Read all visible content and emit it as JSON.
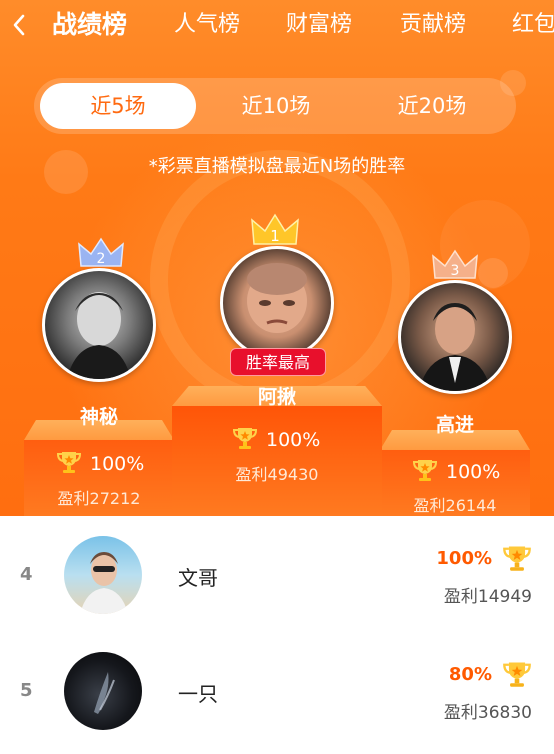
{
  "header": {
    "back_icon": "chevron-left-icon",
    "tabs": [
      {
        "label": "战绩榜",
        "active": true
      },
      {
        "label": "人气榜",
        "active": false
      },
      {
        "label": "财富榜",
        "active": false
      },
      {
        "label": "贡献榜",
        "active": false
      },
      {
        "label": "红包",
        "active": false
      }
    ]
  },
  "range_tabs": [
    {
      "label": "近5场",
      "active": true
    },
    {
      "label": "近10场",
      "active": false
    },
    {
      "label": "近20场",
      "active": false
    }
  ],
  "note": "*彩票直播模拟盘最近N场的胜率",
  "top3": [
    {
      "rank": "1",
      "name": "阿揪",
      "win_rate": "100%",
      "profit": "盈利49430",
      "badge": "胜率最高"
    },
    {
      "rank": "2",
      "name": "神秘",
      "win_rate": "100%",
      "profit": "盈利27212"
    },
    {
      "rank": "3",
      "name": "高进",
      "win_rate": "100%",
      "profit": "盈利26144"
    }
  ],
  "list": [
    {
      "rank": "4",
      "name": "文哥",
      "win_rate": "100%",
      "profit": "盈利14949"
    },
    {
      "rank": "5",
      "name": "一只",
      "win_rate": "80%",
      "profit": "盈利36830"
    }
  ],
  "colors": {
    "brand_orange": "#ff7a16",
    "badge_red": "#e8102c",
    "accent_text": "#ff5a00"
  }
}
